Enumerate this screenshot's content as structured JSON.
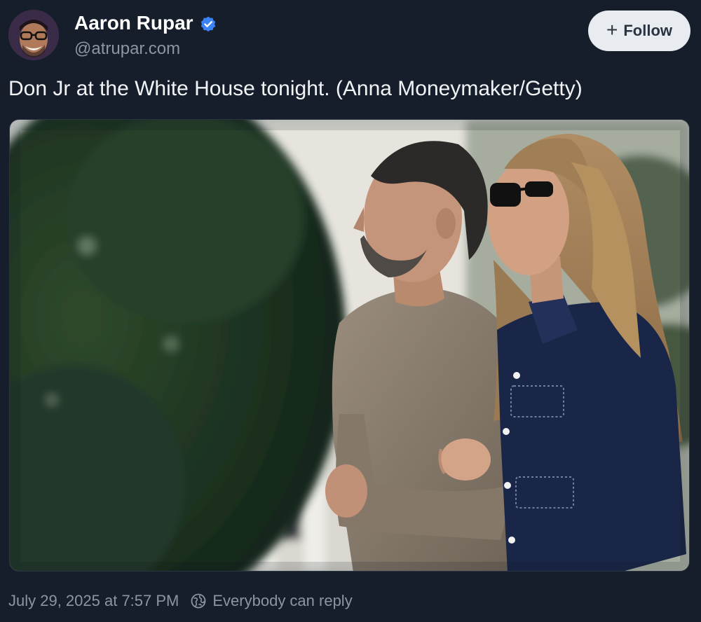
{
  "author": {
    "name": "Aaron Rupar",
    "handle": "@atrupar.com",
    "verified": true
  },
  "follow_button": {
    "label": "Follow"
  },
  "post": {
    "text": "Don Jr at the White House tonight. (Anna Moneymaker/Getty)",
    "timestamp": "July 29, 2025 at 7:57 PM",
    "reply_setting": "Everybody can reply"
  },
  "colors": {
    "background": "#161e2b",
    "verified_badge": "#3b82f6",
    "follow_button_bg": "#e8ebef",
    "muted_text": "#8b95a3"
  },
  "icons": {
    "verified": "verified-checkmark-icon",
    "follow": "plus-icon",
    "reply": "globe-reply-icon"
  }
}
